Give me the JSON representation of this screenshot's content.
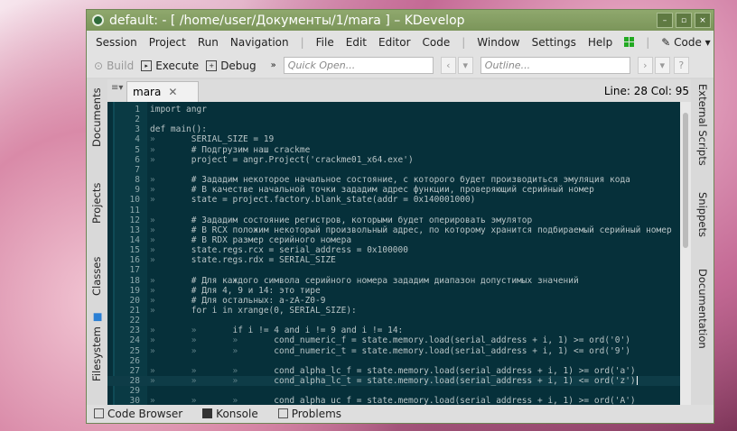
{
  "window": {
    "title": "default:   - [ /home/user/Документы/1/mara ] – KDevelop",
    "controls": [
      "–",
      "▫",
      "×"
    ]
  },
  "menu": {
    "left": [
      "Session",
      "Project",
      "Run",
      "Navigation"
    ],
    "mid": [
      "File",
      "Edit",
      "Editor",
      "Code"
    ],
    "right": [
      "Window",
      "Settings",
      "Help"
    ],
    "area": "Code"
  },
  "toolbar": {
    "build": "Build",
    "execute": "Execute",
    "debug": "Debug",
    "quick_open_placeholder": "Quick Open...",
    "outline_placeholder": "Outline..."
  },
  "editor": {
    "tab": "mara",
    "position": "Line: 28 Col: 95",
    "current_line": 28,
    "lines": [
      {
        "i": 0,
        "t": "import angr"
      },
      {
        "i": 0,
        "t": ""
      },
      {
        "i": 0,
        "t": "def main():"
      },
      {
        "i": 1,
        "t": "SERIAL_SIZE = 19"
      },
      {
        "i": 1,
        "t": "# Подгрузим наш crackme"
      },
      {
        "i": 1,
        "t": "project = angr.Project('crackme01_x64.exe')"
      },
      {
        "i": 0,
        "t": ""
      },
      {
        "i": 1,
        "t": "# Зададим некоторое начальное состояние, с которого будет производиться эмуляция кода"
      },
      {
        "i": 1,
        "t": "# В качестве начальной точки зададим адрес функции, проверяющий серийный номер"
      },
      {
        "i": 1,
        "t": "state = project.factory.blank_state(addr = 0x140001000)"
      },
      {
        "i": 0,
        "t": ""
      },
      {
        "i": 1,
        "t": "# Зададим состояние регистров, которыми будет оперировать эмулятор"
      },
      {
        "i": 1,
        "t": "# В RCX положим некоторый произвольный адрес, по которому хранится подбираемый серийный номер"
      },
      {
        "i": 1,
        "t": "# В RDX размер серийного номера"
      },
      {
        "i": 1,
        "t": "state.regs.rcx = serial_address = 0x100000"
      },
      {
        "i": 1,
        "t": "state.regs.rdx = SERIAL_SIZE"
      },
      {
        "i": 0,
        "t": ""
      },
      {
        "i": 1,
        "t": "# Для каждого символа серийного номера зададим диапазон допустимых значений"
      },
      {
        "i": 1,
        "t": "# Для 4, 9 и 14: это тире"
      },
      {
        "i": 1,
        "t": "# Для остальных: a-zA-Z0-9"
      },
      {
        "i": 1,
        "t": "for i in xrange(0, SERIAL_SIZE):"
      },
      {
        "i": 0,
        "t": ""
      },
      {
        "i": 2,
        "t": "if i != 4 and i != 9 and i != 14:"
      },
      {
        "i": 3,
        "t": "cond_numeric_f = state.memory.load(serial_address + i, 1) >= ord('0')"
      },
      {
        "i": 3,
        "t": "cond_numeric_t = state.memory.load(serial_address + i, 1) <= ord('9')"
      },
      {
        "i": 0,
        "t": ""
      },
      {
        "i": 3,
        "t": "cond_alpha_lc_f = state.memory.load(serial_address + i, 1) >= ord('a')"
      },
      {
        "i": 3,
        "t": "cond_alpha_lc_t = state.memory.load(serial_address + i, 1) <= ord('z')"
      },
      {
        "i": 0,
        "t": ""
      },
      {
        "i": 3,
        "t": "cond_alpha_uc_f = state.memory.load(serial_address + i, 1) >= ord('A')"
      }
    ]
  },
  "left_dock": [
    "Documents",
    "Projects",
    "Classes",
    "Filesystem"
  ],
  "right_dock": [
    "External Scripts",
    "Snippets",
    "Documentation"
  ],
  "bottom": [
    "Code Browser",
    "Konsole",
    "Problems"
  ]
}
